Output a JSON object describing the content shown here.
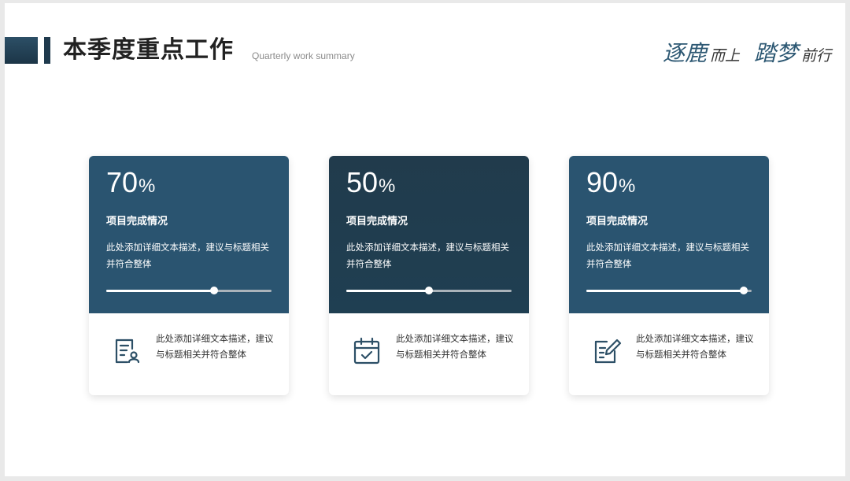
{
  "header": {
    "title": "本季度重点工作",
    "subtitle": "Quarterly work summary",
    "slogan": {
      "part1_big": "逐鹿",
      "part1_small": "而上",
      "part2_big": "踏梦",
      "part2_small": "前行"
    }
  },
  "cards": [
    {
      "percent": "70",
      "percent_sign": "%",
      "progress": 0.65,
      "title": "项目完成情况",
      "description": "此处添加详细文本描述，建议与标题相关并符合整体",
      "icon": "document-user-icon",
      "bottom_text": "此处添加详细文本描述，建议与标题相关并符合整体"
    },
    {
      "percent": "50",
      "percent_sign": "%",
      "progress": 0.5,
      "title": "项目完成情况",
      "description": "此处添加详细文本描述，建议与标题相关并符合整体",
      "icon": "calendar-check-icon",
      "bottom_text": "此处添加详细文本描述，建议与标题相关并符合整体"
    },
    {
      "percent": "90",
      "percent_sign": "%",
      "progress": 0.95,
      "title": "项目完成情况",
      "description": "此处添加详细文本描述，建议与标题相关并符合整体",
      "icon": "edit-document-icon",
      "bottom_text": "此处添加详细文本描述，建议与标题相关并符合整体"
    }
  ],
  "colors": {
    "primary": "#2a5470",
    "dark": "#213b4c",
    "icon": "#2c4f66"
  }
}
